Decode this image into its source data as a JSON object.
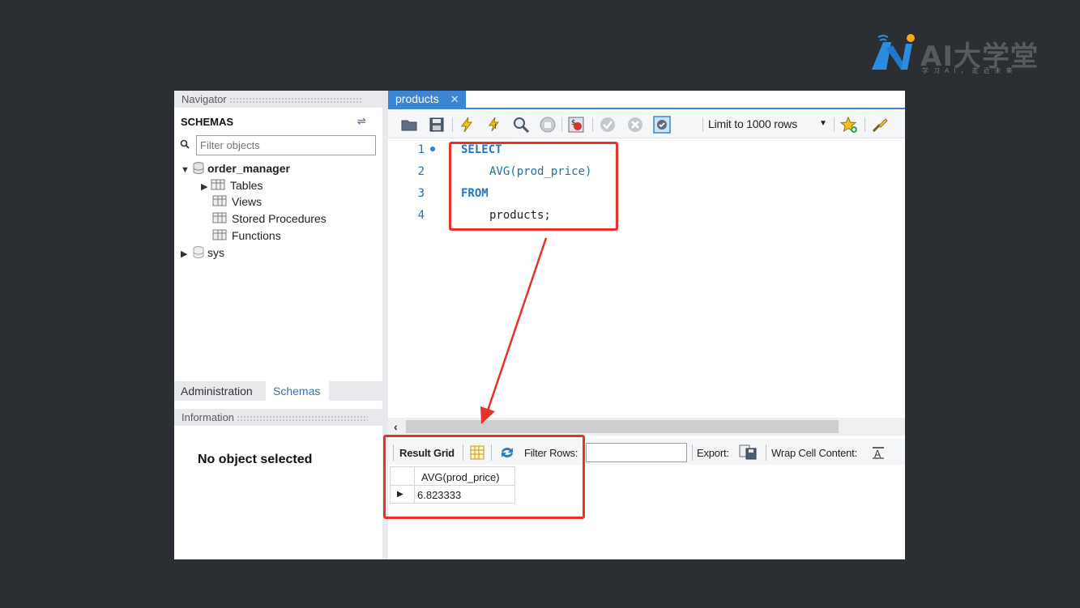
{
  "logo": {
    "text": "AI大学堂",
    "subtitle": "学习AI，走近未来",
    "colors": {
      "blue": "#2a8de0",
      "orange": "#f5a623"
    }
  },
  "navigator": {
    "header": "Navigator",
    "schemas_title": "SCHEMAS",
    "filter_placeholder": "Filter objects",
    "tree": [
      {
        "label": "order_manager",
        "icon": "database-icon",
        "expanded": true
      },
      {
        "label": "Tables",
        "icon": "table-folder-icon",
        "expandable": true
      },
      {
        "label": "Views",
        "icon": "views-folder-icon"
      },
      {
        "label": "Stored Procedures",
        "icon": "procedures-folder-icon"
      },
      {
        "label": "Functions",
        "icon": "functions-folder-icon"
      },
      {
        "label": "sys",
        "icon": "database-icon",
        "expanded": false
      }
    ],
    "tabs": {
      "admin": "Administration",
      "schemas": "Schemas"
    },
    "info_header": "Information",
    "no_object": "No object selected"
  },
  "query_tab": {
    "label": "products",
    "close": "✕"
  },
  "toolbar": {
    "limit_label": "Limit to 1000 rows"
  },
  "editor": {
    "lines": [
      {
        "num": "1",
        "text": "SELECT",
        "kind": "keyword",
        "indent": 0
      },
      {
        "num": "2",
        "text": "AVG(prod_price)",
        "kind": "function",
        "indent": 1
      },
      {
        "num": "3",
        "text": "FROM",
        "kind": "keyword",
        "indent": 0
      },
      {
        "num": "4",
        "text": "products;",
        "kind": "text",
        "indent": 1
      }
    ]
  },
  "results": {
    "result_grid_label": "Result Grid",
    "filter_rows_label": "Filter Rows:",
    "export_label": "Export:",
    "wrap_label": "Wrap Cell Content:",
    "column": "AVG(prod_price)",
    "value": "6.823333"
  },
  "colors": {
    "accent": "#3a86d4",
    "highlight": "#e8312a",
    "background": "#2b2e33"
  }
}
